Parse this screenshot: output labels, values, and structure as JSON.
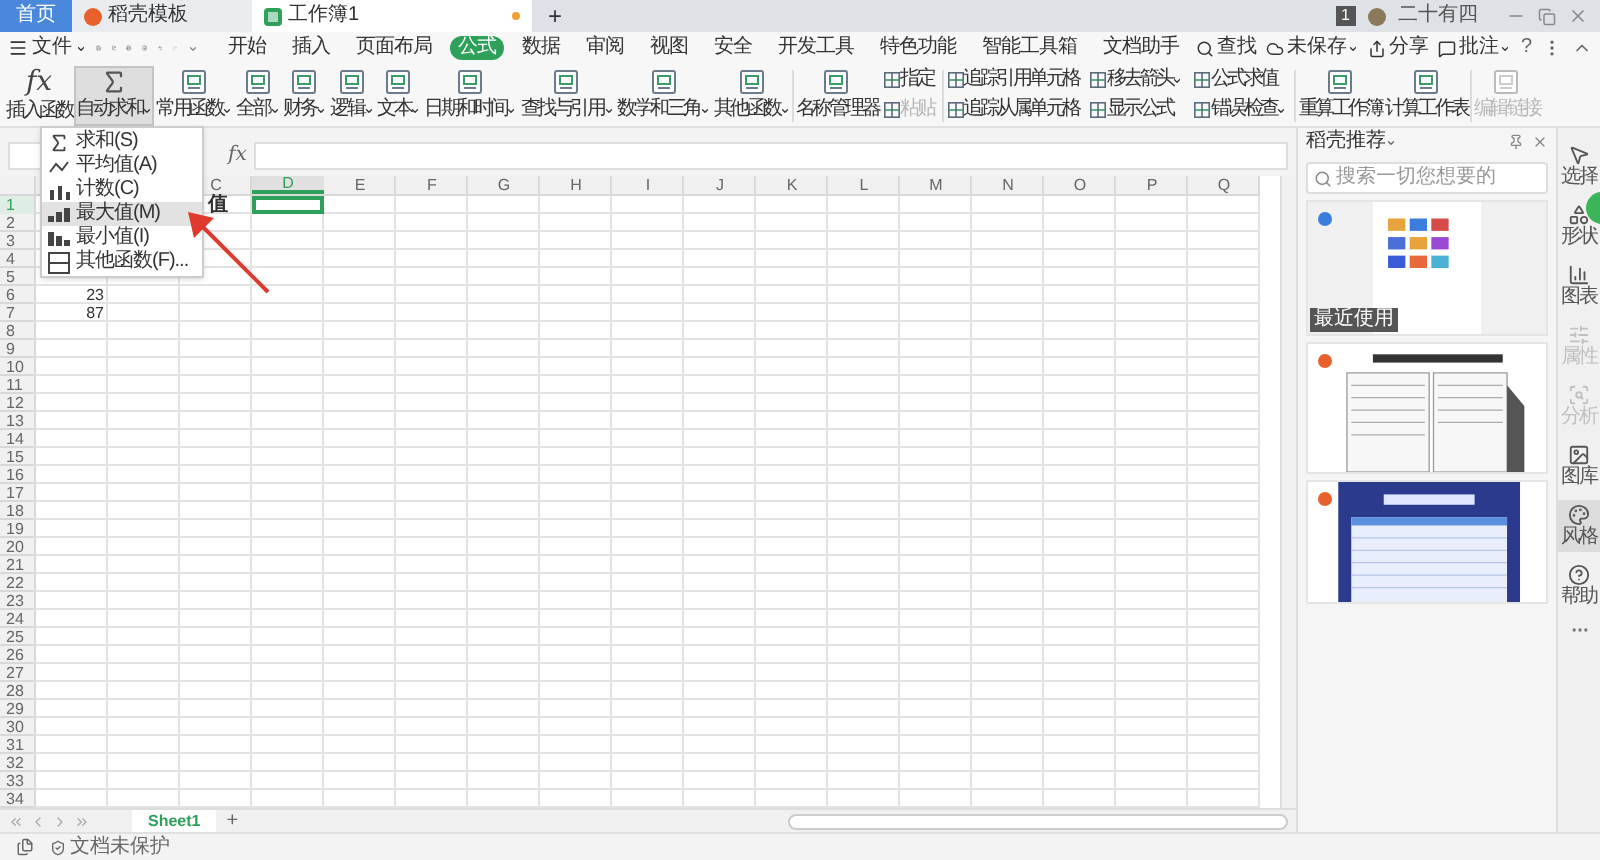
{
  "tabs": [
    {
      "label": "首页",
      "kind": "home",
      "selected": false
    },
    {
      "label": "稻壳模板",
      "kind": "docer",
      "selected": false
    },
    {
      "label": "工作簿1",
      "kind": "sheet",
      "selected": true
    }
  ],
  "new_tab": "+",
  "account": {
    "badge": "1",
    "name": "二十有四"
  },
  "menu": {
    "file": "文件",
    "tabs": [
      {
        "label": "开始",
        "selected": false
      },
      {
        "label": "插入",
        "selected": false
      },
      {
        "label": "页面布局",
        "selected": false
      },
      {
        "label": "公式",
        "selected": true
      },
      {
        "label": "数据",
        "selected": false
      },
      {
        "label": "审阅",
        "selected": false
      },
      {
        "label": "视图",
        "selected": false
      },
      {
        "label": "安全",
        "selected": false
      },
      {
        "label": "开发工具",
        "selected": false
      },
      {
        "label": "特色功能",
        "selected": false
      },
      {
        "label": "智能工具箱",
        "selected": false
      },
      {
        "label": "文档助手",
        "selected": false
      }
    ],
    "search": "查找",
    "actions": [
      {
        "label": "未保存",
        "kind": "cloud",
        "dropdown": true
      },
      {
        "label": "分享",
        "kind": "share",
        "dropdown": false
      },
      {
        "label": "批注",
        "kind": "comment",
        "dropdown": true
      }
    ],
    "help": "?"
  },
  "ribbon": [
    {
      "kind": "glyph",
      "glyph": "fx",
      "label": "插入函数",
      "dropdown": false,
      "pressed": false,
      "disabled": false
    },
    {
      "kind": "sum",
      "label": "自动求和",
      "dropdown": true,
      "pressed": true,
      "disabled": false
    },
    {
      "kind": "large",
      "label": "常用函数",
      "dropdown": true,
      "pressed": false,
      "disabled": false
    },
    {
      "kind": "large",
      "label": "全部",
      "dropdown": true,
      "pressed": false,
      "disabled": false
    },
    {
      "kind": "large",
      "label": "财务",
      "dropdown": true,
      "pressed": false,
      "disabled": false
    },
    {
      "kind": "large",
      "label": "逻辑",
      "dropdown": true,
      "pressed": false,
      "disabled": false
    },
    {
      "kind": "large",
      "label": "文本",
      "dropdown": true,
      "pressed": false,
      "disabled": false
    },
    {
      "kind": "large",
      "label": "日期和时间",
      "dropdown": true,
      "pressed": false,
      "disabled": false
    },
    {
      "kind": "large",
      "label": "查找与引用",
      "dropdown": true,
      "pressed": false,
      "disabled": false
    },
    {
      "kind": "large",
      "label": "数学和三角",
      "dropdown": true,
      "pressed": false,
      "disabled": false
    },
    {
      "kind": "large",
      "label": "其他函数",
      "dropdown": true,
      "pressed": false,
      "disabled": false
    },
    {
      "kind": "separator"
    },
    {
      "kind": "large",
      "label": "名称管理器",
      "dropdown": false,
      "pressed": false,
      "disabled": false
    },
    {
      "kind": "stack",
      "items": [
        {
          "label": "指定",
          "dropdown": false,
          "disabled": false
        },
        {
          "label": "粘贴",
          "dropdown": false,
          "disabled": true
        }
      ]
    },
    {
      "kind": "separator"
    },
    {
      "kind": "stack",
      "items": [
        {
          "label": "追踪引用单元格",
          "dropdown": false,
          "disabled": false
        },
        {
          "label": "追踪从属单元格",
          "dropdown": false,
          "disabled": false
        }
      ]
    },
    {
      "kind": "stack",
      "items": [
        {
          "label": "移去箭头",
          "dropdown": true,
          "disabled": false
        },
        {
          "label": "显示公式",
          "dropdown": false,
          "disabled": false
        }
      ]
    },
    {
      "kind": "stack",
      "items": [
        {
          "label": "公式求值",
          "dropdown": false,
          "disabled": false
        },
        {
          "label": "错误检查",
          "dropdown": true,
          "disabled": false
        }
      ]
    },
    {
      "kind": "separator"
    },
    {
      "kind": "large",
      "label": "重算工作簿",
      "dropdown": false,
      "pressed": false,
      "disabled": false
    },
    {
      "kind": "large",
      "label": "计算工作表",
      "dropdown": false,
      "pressed": false,
      "disabled": false
    },
    {
      "kind": "separator"
    },
    {
      "kind": "large",
      "label": "编辑链接",
      "dropdown": false,
      "pressed": false,
      "disabled": true
    }
  ],
  "dropdown": [
    {
      "kind": "sum",
      "label": "求和(S)",
      "highlighted": false
    },
    {
      "kind": "average",
      "label": "平均值(A)",
      "highlighted": false
    },
    {
      "kind": "count",
      "label": "计数(C)",
      "highlighted": false
    },
    {
      "kind": "max",
      "label": "最大值(M)",
      "highlighted": true
    },
    {
      "kind": "min",
      "label": "最小值(I)",
      "highlighted": false
    },
    {
      "kind": "more",
      "label": "其他函数(F)...",
      "highlighted": false
    }
  ],
  "formula_bar": {
    "glyph": "fx"
  },
  "sheet": {
    "columns": [
      {
        "selected": false
      },
      {},
      {
        "label": "C",
        "selected": false
      },
      {
        "label": "D",
        "selected": true
      },
      {
        "label": "E",
        "selected": false
      },
      {
        "label": "F",
        "selected": false
      },
      {
        "label": "G",
        "selected": false
      },
      {
        "label": "H",
        "selected": false
      },
      {
        "label": "I",
        "selected": false
      },
      {
        "label": "J",
        "selected": false
      },
      {
        "label": "K",
        "selected": false
      },
      {
        "label": "L",
        "selected": false
      },
      {
        "label": "M",
        "selected": false
      },
      {
        "label": "N",
        "selected": false
      },
      {
        "label": "O",
        "selected": false
      },
      {
        "label": "P",
        "selected": false
      },
      {
        "label": "Q",
        "selected": false
      }
    ],
    "rows": [
      {
        "label": "1",
        "selected": true,
        "cells": [
          {
            "kind": "empty"
          },
          {
            "kind": "empty"
          },
          {
            "kind": "text",
            "text": "值",
            "selected": false
          },
          {
            "kind": "empty",
            "selected": true
          }
        ]
      },
      {
        "label": "2",
        "selected": false
      },
      {
        "label": "3",
        "selected": false
      },
      {
        "label": "4",
        "selected": false
      },
      {
        "label": "5",
        "selected": false
      },
      {
        "label": "6",
        "selected": false,
        "cells": [
          {
            "kind": "number",
            "text": "23",
            "selected": false
          }
        ]
      },
      {
        "label": "7",
        "selected": false,
        "cells": [
          {
            "kind": "number",
            "text": "87",
            "selected": false
          }
        ]
      },
      {
        "label": "8",
        "selected": false
      },
      {
        "label": "9",
        "selected": false
      },
      {
        "label": "10",
        "selected": false
      },
      {
        "label": "11",
        "selected": false
      },
      {
        "label": "12",
        "selected": false
      },
      {
        "label": "13",
        "selected": false
      },
      {
        "label": "14",
        "selected": false
      },
      {
        "label": "15",
        "selected": false
      },
      {
        "label": "16",
        "selected": false
      },
      {
        "label": "17",
        "selected": false
      },
      {
        "label": "18",
        "selected": false
      },
      {
        "label": "19",
        "selected": false
      },
      {
        "label": "20",
        "selected": false
      },
      {
        "label": "21",
        "selected": false
      },
      {
        "label": "22",
        "selected": false
      },
      {
        "label": "23",
        "selected": false
      },
      {
        "label": "24",
        "selected": false
      },
      {
        "label": "25",
        "selected": false
      },
      {
        "label": "26",
        "selected": false
      },
      {
        "label": "27",
        "selected": false
      },
      {
        "label": "28",
        "selected": false
      },
      {
        "label": "29",
        "selected": false
      },
      {
        "label": "30",
        "selected": false
      },
      {
        "label": "31",
        "selected": false
      },
      {
        "label": "32",
        "selected": false
      },
      {
        "label": "33",
        "selected": false
      },
      {
        "label": "34",
        "selected": false
      }
    ]
  },
  "sheet_tabs": [
    {
      "label": "Sheet1",
      "selected": true
    }
  ],
  "add_sheet": "+",
  "status": {
    "protection": "文档未保护"
  },
  "panel": {
    "title": "稻壳推荐",
    "search": {
      "placeholder": "搜索一切您想要的"
    },
    "cards": [
      {
        "kind": "recent",
        "color": "#3b7ddd",
        "tag": "最近使用"
      },
      {
        "kind": "form",
        "color": "#e8612c"
      },
      {
        "kind": "dark",
        "color": "#e8612c"
      }
    ]
  },
  "side_tools": [
    {
      "kind": "select",
      "label": "选择",
      "disabled": false,
      "selected": false
    },
    {
      "kind": "shape",
      "label": "形状",
      "disabled": false,
      "selected": false
    },
    {
      "kind": "chart",
      "label": "图表",
      "disabled": false,
      "selected": false
    },
    {
      "kind": "properties",
      "label": "属性",
      "disabled": true,
      "selected": false
    },
    {
      "kind": "analysis",
      "label": "分析",
      "disabled": true,
      "selected": false
    },
    {
      "kind": "gallery",
      "label": "图库",
      "disabled": false,
      "selected": false
    },
    {
      "kind": "style",
      "label": "风格",
      "disabled": false,
      "selected": true
    },
    {
      "kind": "help",
      "label": "帮助",
      "disabled": false,
      "selected": false
    }
  ]
}
